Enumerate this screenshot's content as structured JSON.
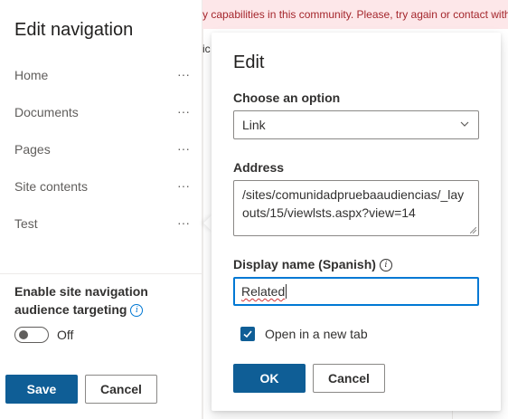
{
  "background": {
    "error_message": "y capabilities in this community. Please, try again or contact with",
    "fragment_text": "ic"
  },
  "nav_panel": {
    "title": "Edit navigation",
    "more_label": "···",
    "items": [
      {
        "label": "Home"
      },
      {
        "label": "Documents"
      },
      {
        "label": "Pages"
      },
      {
        "label": "Site contents"
      },
      {
        "label": "Test"
      }
    ],
    "targeting_label": "Enable site navigation audience targeting",
    "toggle_state": "Off",
    "save_label": "Save",
    "cancel_label": "Cancel"
  },
  "edit_callout": {
    "title": "Edit",
    "choose_label": "Choose an option",
    "choose_value": "Link",
    "address_label": "Address",
    "address_value": "/sites/comunidadpruebaaudiencias/_layouts/15/viewlsts.aspx?view=14",
    "display_name_label": "Display name (Spanish)",
    "display_name_value": "Related",
    "open_new_tab_label": "Open in a new tab",
    "open_new_tab_checked": true,
    "ok_label": "OK",
    "cancel_label": "Cancel"
  },
  "colors": {
    "primary": "#0f5e96",
    "focus_border": "#0078d4",
    "error_bg": "#fde7e9",
    "error_text": "#a4262c"
  },
  "icons": [
    "info-icon",
    "chevron-down-icon",
    "checkmark-icon",
    "more-icon"
  ]
}
